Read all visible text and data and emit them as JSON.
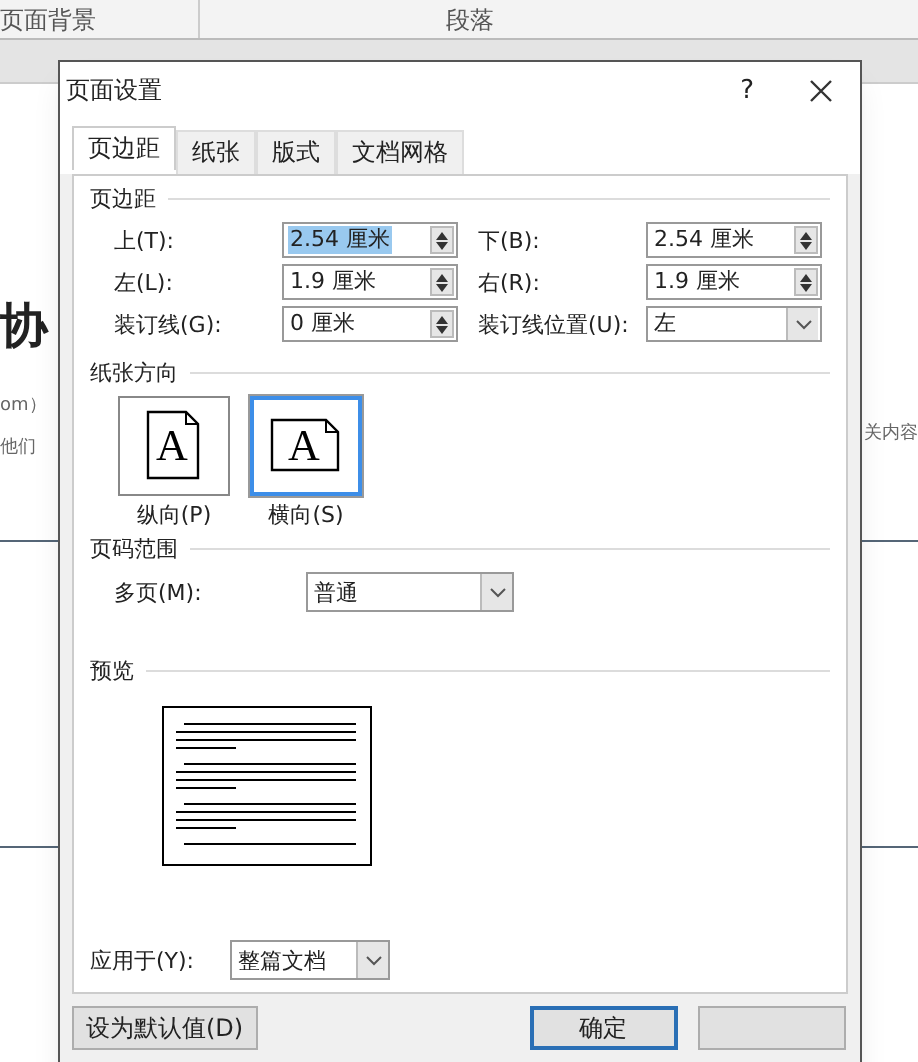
{
  "background": {
    "ribbon_groups": [
      "页面背景",
      "段落"
    ],
    "left_fragments": [
      "协",
      "om）",
      "他们"
    ],
    "right_fragments": [
      "关内容"
    ]
  },
  "dialog": {
    "title": "页面设置",
    "help": "?",
    "tabs": [
      {
        "label": "页边距",
        "selected": true
      },
      {
        "label": "纸张",
        "selected": false
      },
      {
        "label": "版式",
        "selected": false
      },
      {
        "label": "文档网格",
        "selected": false
      }
    ],
    "margins": {
      "heading": "页边距",
      "fields": [
        {
          "kind": "spinner",
          "label": "上(T):",
          "value": "2.54 厘米",
          "selected": true
        },
        {
          "kind": "spinner",
          "label": "下(B):",
          "value": "2.54 厘米",
          "selected": false
        },
        {
          "kind": "spinner",
          "label": "左(L):",
          "value": "1.9 厘米",
          "selected": false
        },
        {
          "kind": "spinner",
          "label": "右(R):",
          "value": "1.9 厘米",
          "selected": false
        },
        {
          "kind": "spinner",
          "label": "装订线(G):",
          "value": "0 厘米",
          "selected": false
        },
        {
          "kind": "dropdown",
          "label": "装订线位置(U):",
          "value": "左",
          "selected": false
        }
      ]
    },
    "orientation": {
      "heading": "纸张方向",
      "options": [
        {
          "kind": "portrait",
          "letter": "A",
          "label": "纵向(P)",
          "selected": false
        },
        {
          "kind": "landscape",
          "letter": "A",
          "label": "横向(S)",
          "selected": true
        }
      ]
    },
    "pages": {
      "heading": "页码范围",
      "label": "多页(M):",
      "value": "普通"
    },
    "preview": {
      "heading": "预览"
    },
    "apply": {
      "label": "应用于(Y):",
      "value": "整篇文档"
    },
    "buttons": [
      {
        "kind": "default",
        "label": "设为默认值(D)"
      },
      {
        "kind": "ok",
        "label": "确定"
      },
      {
        "kind": "blank"
      }
    ]
  }
}
